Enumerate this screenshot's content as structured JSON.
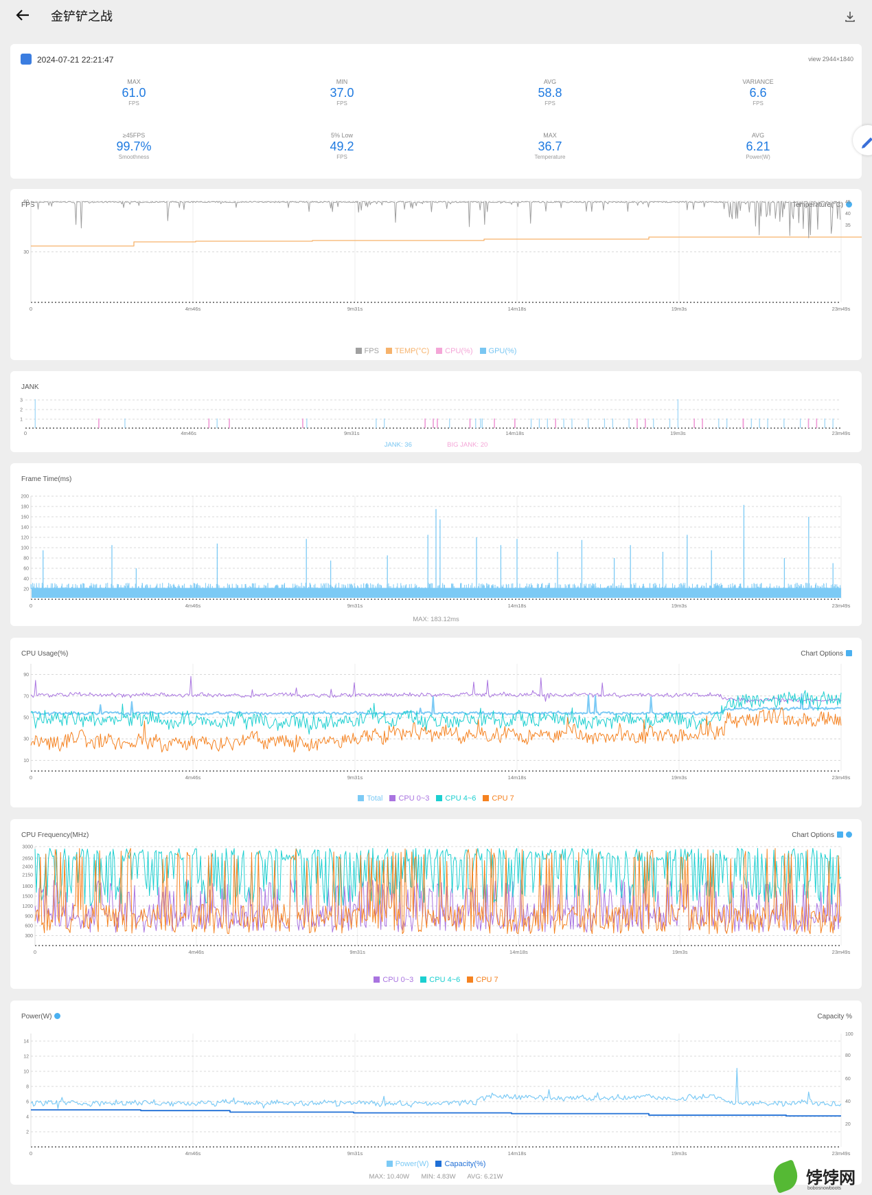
{
  "header": {
    "title": "金铲铲之战"
  },
  "summary": {
    "datetime": "2024-07-21 22:21:47",
    "view": "view 2944×1840",
    "stats": [
      {
        "label": "MAX",
        "value": "61.0",
        "sub": "FPS"
      },
      {
        "label": "MIN",
        "value": "37.0",
        "sub": "FPS"
      },
      {
        "label": "AVG",
        "value": "58.8",
        "sub": "FPS"
      },
      {
        "label": "VARIANCE",
        "value": "6.6",
        "sub": "FPS"
      },
      {
        "label": "≥45FPS",
        "value": "99.7%",
        "sub": "Smoothness"
      },
      {
        "label": "5% Low",
        "value": "49.2",
        "sub": "FPS"
      },
      {
        "label": "MAX",
        "value": "36.7",
        "sub": "Temperature"
      },
      {
        "label": "AVG",
        "value": "6.21",
        "sub": "Power(W)"
      }
    ]
  },
  "time_labels": [
    "0",
    "4m46s",
    "9m31s",
    "14m18s",
    "19m3s",
    "23m49s"
  ],
  "fps_chart": {
    "title": "FPS",
    "right_title": "Temperature(°C)",
    "legend": [
      {
        "name": "FPS",
        "color": "#a0a0a0"
      },
      {
        "name": "TEMP(°C)",
        "color": "#f6b26b"
      },
      {
        "name": "CPU(%)",
        "color": "#f4a6d7"
      },
      {
        "name": "GPU(%)",
        "color": "#79c6f2"
      }
    ]
  },
  "jank_chart": {
    "title": "JANK",
    "jank_label": "JANK: 36",
    "big_jank_label": "BIG JANK: 20"
  },
  "frametime_chart": {
    "title": "Frame Time(ms)",
    "note": "MAX: 183.12ms"
  },
  "cpu_usage_chart": {
    "title": "CPU Usage(%)",
    "options": "Chart Options",
    "legend": [
      {
        "name": "Total",
        "color": "#7ccaf5"
      },
      {
        "name": "CPU 0~3",
        "color": "#a974e0"
      },
      {
        "name": "CPU 4~6",
        "color": "#1ccfd0"
      },
      {
        "name": "CPU 7",
        "color": "#f58220"
      }
    ]
  },
  "cpu_freq_chart": {
    "title": "CPU Frequency(MHz)",
    "options": "Chart Options",
    "legend": [
      {
        "name": "CPU 0~3",
        "color": "#a974e0"
      },
      {
        "name": "CPU 4~6",
        "color": "#1ccfd0"
      },
      {
        "name": "CPU 7",
        "color": "#f58220"
      }
    ]
  },
  "power_chart": {
    "title": "Power(W)",
    "right_title": "Capacity %",
    "legend": [
      {
        "name": "Power(W)",
        "color": "#7ccaf5"
      },
      {
        "name": "Capacity(%)",
        "color": "#1f6fd6"
      }
    ],
    "note_max": "MAX: 10.40W",
    "note_min": "MIN: 4.83W",
    "note_avg": "AVG: 6.21W"
  },
  "watermark": {
    "text": "饽饽网",
    "url": "bobosnowboots"
  },
  "chart_data": [
    {
      "type": "line",
      "title": "FPS",
      "x_range": [
        "0",
        "23m49s"
      ],
      "ylim": [
        0,
        60
      ],
      "y_ticks": [
        30,
        60
      ],
      "right_ylim": [
        35,
        45
      ],
      "right_ticks": [
        35,
        40,
        45
      ],
      "series": [
        {
          "name": "FPS",
          "approx_level": 60,
          "min": 37.0,
          "max": 61.0,
          "avg": 58.8
        },
        {
          "name": "TEMP(°C)",
          "approx_range": [
            27,
            36.7
          ]
        }
      ]
    },
    {
      "type": "bar",
      "title": "JANK",
      "y_ticks": [
        1,
        2,
        3
      ],
      "series": [
        {
          "name": "JANK",
          "count": 36
        },
        {
          "name": "BIG JANK",
          "count": 20
        }
      ]
    },
    {
      "type": "bar",
      "title": "Frame Time(ms)",
      "ylim": [
        0,
        200
      ],
      "y_ticks": [
        20,
        40,
        60,
        80,
        100,
        120,
        140,
        160,
        180,
        200
      ],
      "max": 183.12
    },
    {
      "type": "line",
      "title": "CPU Usage(%)",
      "ylim": [
        0,
        100
      ],
      "y_ticks": [
        10,
        30,
        50,
        70,
        90
      ],
      "series": [
        {
          "name": "Total",
          "approx_level": 55
        },
        {
          "name": "CPU 0~3",
          "approx_level": 71
        },
        {
          "name": "CPU 4~6",
          "approx_level": 50
        },
        {
          "name": "CPU 7",
          "approx_level": 28
        }
      ]
    },
    {
      "type": "line",
      "title": "CPU Frequency(MHz)",
      "y_ticks": [
        300,
        600,
        900,
        1200,
        1500,
        1800,
        2150,
        2400,
        2650,
        3000
      ],
      "series": [
        {
          "name": "CPU 0~3"
        },
        {
          "name": "CPU 4~6"
        },
        {
          "name": "CPU 7"
        }
      ]
    },
    {
      "type": "line",
      "title": "Power(W)",
      "ylim": [
        0,
        15
      ],
      "y_ticks": [
        2,
        4,
        6,
        8,
        10,
        12,
        14
      ],
      "right_ticks": [
        20,
        40,
        60,
        80,
        100
      ],
      "series": [
        {
          "name": "Power(W)",
          "max": 10.4,
          "min": 4.83,
          "avg": 6.21
        },
        {
          "name": "Capacity(%)",
          "approx_range": [
            40,
            50
          ]
        }
      ]
    }
  ]
}
